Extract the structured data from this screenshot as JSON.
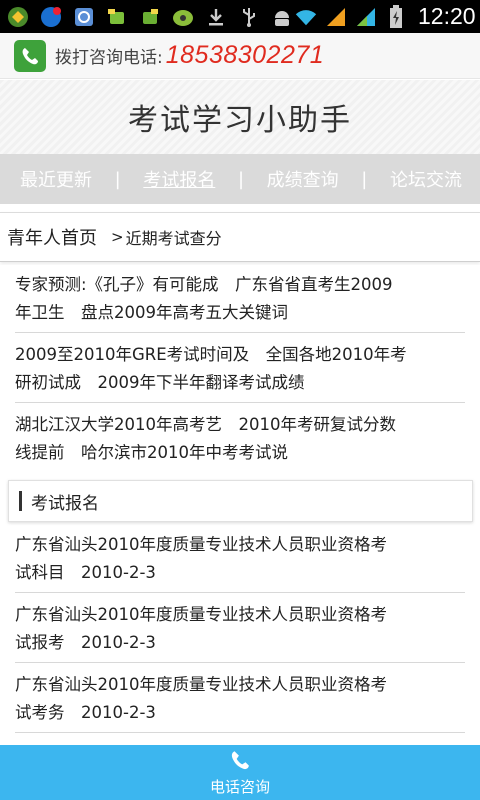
{
  "status_bar": {
    "time": "12:20",
    "icons": [
      "pandaspace-icon",
      "qq-notification-icon",
      "mms-icon",
      "android-game-icon",
      "android-game-icon",
      "app-icon",
      "download-icon",
      "usb-icon",
      "android-icon",
      "wifi-icon",
      "signal-icon",
      "signal-icon",
      "battery-icon"
    ]
  },
  "phone_bar": {
    "label": "拨打咨询电话:",
    "number": "18538302271"
  },
  "header": {
    "title": "考试学习小助手"
  },
  "nav": {
    "items": [
      {
        "label": "最近更新"
      },
      {
        "label": "考试报名"
      },
      {
        "label": "成绩查询"
      },
      {
        "label": "论坛交流"
      }
    ],
    "separator": "|"
  },
  "breadcrumb": {
    "home": "青年人首页",
    "arrow": ">",
    "current": "近期考试查分"
  },
  "news_items": [
    {
      "line1": "专家预测:《孔子》有可能成　广东省省直考生2009",
      "line2": "年卫生　盘点2009年高考五大关键词"
    },
    {
      "line1": "2009至2010年GRE考试时间及　全国各地2010年考",
      "line2": "研初试成　2009年下半年翻译考试成绩"
    },
    {
      "line1": "湖北江汉大学2010年高考艺　2010年考研复试分数",
      "line2": "线提前　哈尔滨市2010年中考考试说"
    }
  ],
  "section": {
    "title": "考试报名"
  },
  "exam_items": [
    {
      "line1": "广东省汕头2010年度质量专业技术人员职业资格考",
      "line2": "试科目　2010-2-3"
    },
    {
      "line1": "广东省汕头2010年度质量专业技术人员职业资格考",
      "line2": "试报考　2010-2-3"
    },
    {
      "line1": "广东省汕头2010年度质量专业技术人员职业资格考",
      "line2": "试考务　2010-2-3"
    }
  ],
  "bottom_bar": {
    "label": "电话咨询"
  },
  "colors": {
    "phone_green": "#3ea23b",
    "phone_red": "#e02b1f",
    "nav_gray": "#dadada",
    "bottom_blue": "#3cb6ef"
  }
}
